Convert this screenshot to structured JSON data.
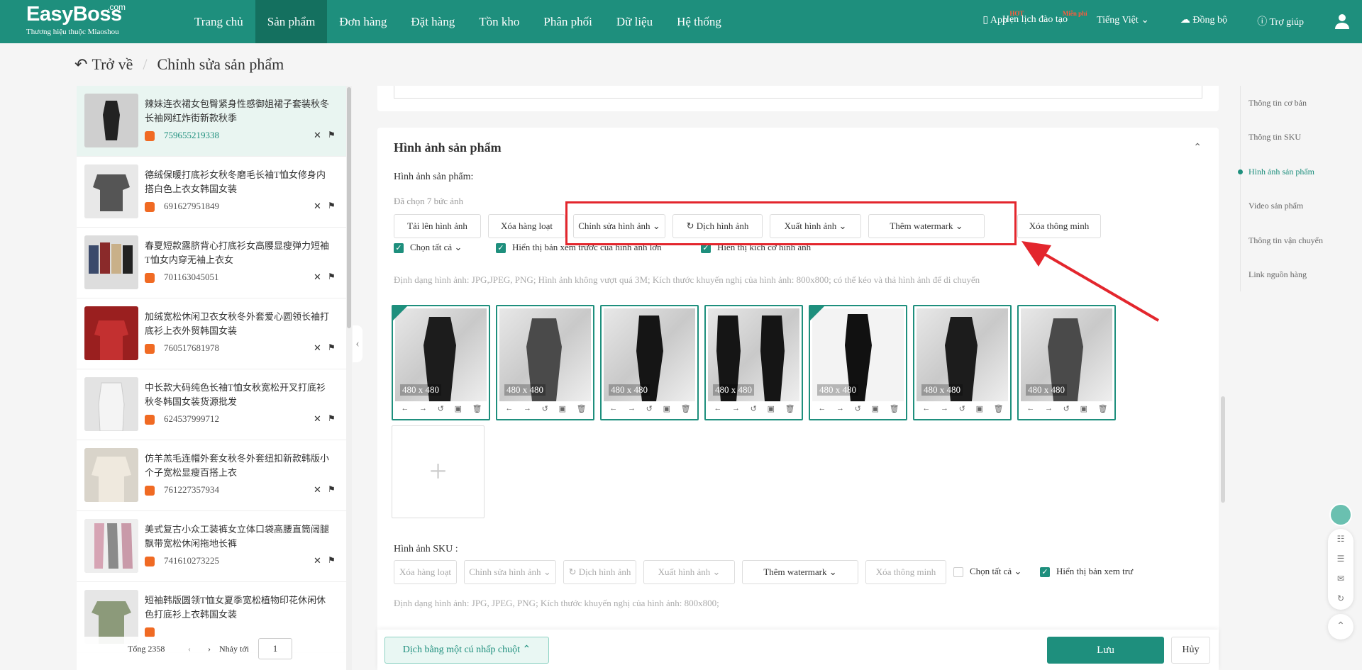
{
  "brand": {
    "name": "EasyBoss",
    "com": ".com",
    "tagline": "Thương hiệu thuộc Miaoshou"
  },
  "nav": [
    "Trang chủ",
    "Sản phẩm",
    "Đơn hàng",
    "Đặt hàng",
    "Tồn kho",
    "Phân phối",
    "Dữ liệu",
    "Hệ thống"
  ],
  "topright": {
    "app": "App",
    "app_badge": "HOT",
    "training": "Hẹn lịch đào tạo",
    "training_badge": "Miễn phí",
    "language": "Tiếng Việt",
    "sync": "Đồng bộ",
    "help": "Trợ giúp"
  },
  "header": {
    "back": "Trở về",
    "title": "Chỉnh sửa sản phẩm"
  },
  "products": [
    {
      "title": "辣妹连衣裙女包臀紧身性感御姐裙子套装秋冬长袖网红炸街新款秋季",
      "id": "759655219338"
    },
    {
      "title": "德绒保暖打底衫女秋冬磨毛长袖T恤女修身内搭白色上衣女韩国女装",
      "id": "691627951849"
    },
    {
      "title": "春夏短款露脐背心打底衫女高腰显瘦弹力短袖T恤女内穿无袖上衣女",
      "id": "701163045051"
    },
    {
      "title": "加绒宽松休闲卫衣女秋冬外套爱心圆领长袖打底衫上衣外贸韩国女装",
      "id": "760517681978"
    },
    {
      "title": "中长款大码纯色长袖T恤女秋宽松开叉打底衫秋冬韩国女装货源批发",
      "id": "624537999712"
    },
    {
      "title": "仿羊羔毛连帽外套女秋冬外套纽扣新款韩版小个子宽松显瘦百搭上衣",
      "id": "761227357934"
    },
    {
      "title": "美式复古小众工装裤女立体口袋高腰直筒阔腿飘带宽松休闲拖地长裤",
      "id": "741610273225"
    },
    {
      "title": "短袖韩版圆领T恤女夏季宽松植物印花休闲休色打底衫上衣韩国女装",
      "id": ""
    }
  ],
  "pager": {
    "total": "Tổng 2358",
    "jump_label": "Nhảy tới",
    "page": "1"
  },
  "section": {
    "title": "Hình ảnh sản phẩm",
    "label": "Hình ảnh sản phẩm:",
    "selected": "Đã chọn 7 bức ảnh",
    "buttons": [
      "Tải lên hình ảnh",
      "Xóa hàng loạt",
      "Chỉnh sửa hình ảnh",
      "Dịch hình ảnh",
      "Xuất hình ảnh",
      "Thêm watermark",
      "Xóa thông minh"
    ],
    "checks": [
      "Chọn tất cả",
      "Hiển thị bản xem trước của hình ảnh lớn",
      "Hiển thị kích cỡ hình ảnh"
    ],
    "hint": "Định dạng hình ảnh: JPG,JPEG, PNG; Hình ảnh không vượt quá 3M; Kích thước khuyến nghị của hình ảnh: 800x800; có thể kéo và thả hình ảnh để di chuyển",
    "images": [
      "480 x 480",
      "480 x 480",
      "480 x 480",
      "480 x 480",
      "480 x 480",
      "480 x 480",
      "480 x 480"
    ]
  },
  "sku": {
    "label": "Hình ảnh SKU :",
    "buttons": [
      "Xóa hàng loạt",
      "Chỉnh sửa hình ảnh",
      "Dịch hình ảnh",
      "Xuất hình ảnh",
      "Thêm watermark",
      "Xóa thông minh"
    ],
    "select_all": "Chọn tất cả",
    "preview": "Hiển thị bản xem trư",
    "hint": "Định dạng hình ảnh: JPG, JPEG, PNG; Kích thước khuyến nghị của hình ảnh: 800x800;"
  },
  "anchors": [
    "Thông tin cơ bản",
    "Thông tin SKU",
    "Hình ảnh sản phẩm",
    "Video sản phẩm",
    "Thông tin vận chuyển",
    "Link nguồn hàng"
  ],
  "bottom": {
    "translate": "Dịch bằng một cú nhấp chuột",
    "save": "Lưu",
    "cancel": "Hủy"
  },
  "colors": {
    "brand": "#1e8f7d",
    "highlight": "#e3262d"
  }
}
